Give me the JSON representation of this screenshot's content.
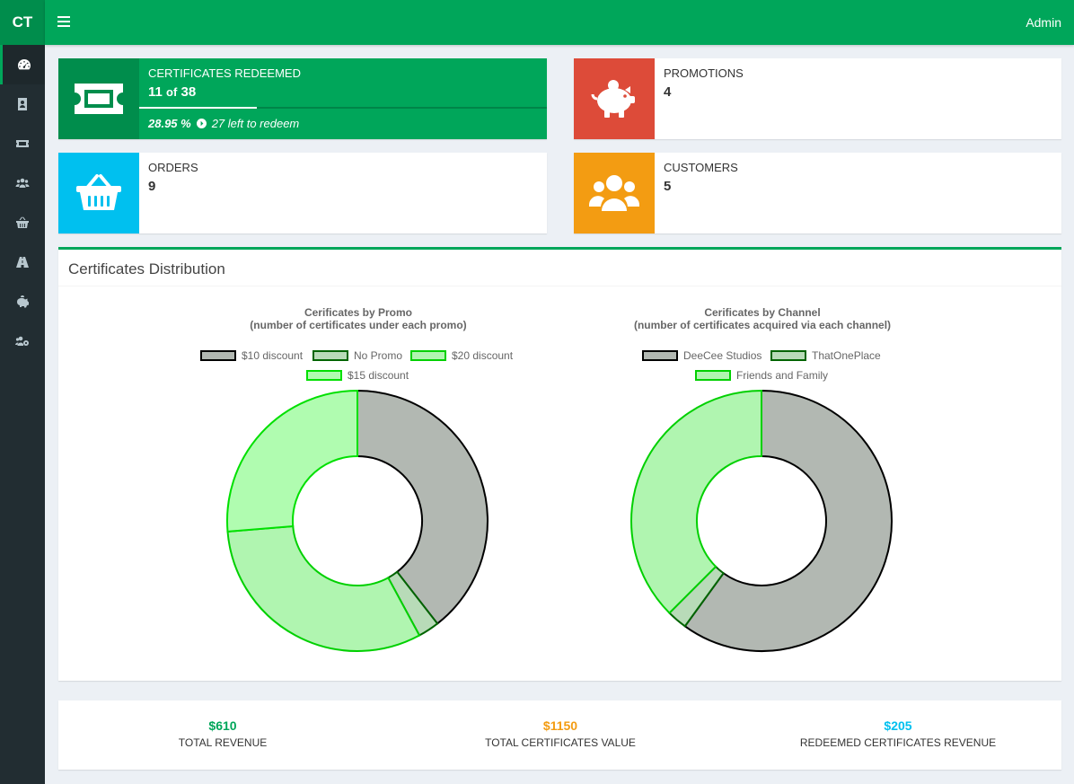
{
  "app": {
    "logo": "CT",
    "user": "Admin"
  },
  "sidebar": {
    "items": [
      {
        "icon": "dashboard-icon",
        "active": true
      },
      {
        "icon": "address-book-icon"
      },
      {
        "icon": "ticket-icon"
      },
      {
        "icon": "users-icon"
      },
      {
        "icon": "basket-icon"
      },
      {
        "icon": "road-icon"
      },
      {
        "icon": "piggy-bank-icon"
      },
      {
        "icon": "users-cog-icon"
      }
    ]
  },
  "info_boxes": {
    "certificates": {
      "label": "CERTIFICATES REDEEMED",
      "value": "11",
      "of": "of",
      "total": "38",
      "progress_percent": 28.95,
      "percent_text": "28.95 %",
      "left_text": "27 left to redeem",
      "color": "#00a65a"
    },
    "promotions": {
      "label": "PROMOTIONS",
      "value": "4",
      "color": "#dd4b39"
    },
    "orders": {
      "label": "ORDERS",
      "value": "9",
      "color": "#00c0ef"
    },
    "customers": {
      "label": "CUSTOMERS",
      "value": "5",
      "color": "#f39c12"
    }
  },
  "distribution": {
    "title": "Certificates Distribution"
  },
  "chart_data": [
    {
      "type": "pie",
      "title": "Cerificates by Promo",
      "subtitle": "(number of certificates under each promo)",
      "categories": [
        "$10 discount",
        "No Promo",
        "$20 discount",
        "$15 discount"
      ],
      "values": [
        15,
        1,
        12,
        10
      ],
      "colors": [
        "#b2b8b2",
        "#b8dbb8",
        "#b0f5b0",
        "#b0fcb0"
      ],
      "borders": [
        "#000000",
        "#006400",
        "#00d000",
        "#00e000"
      ]
    },
    {
      "type": "pie",
      "title": "Cerificates by Channel",
      "subtitle": "(number of certificates acquired via each channel)",
      "categories": [
        "DeeCee Studios",
        "ThatOnePlace",
        "Friends and Family"
      ],
      "values": [
        24,
        1,
        15
      ],
      "colors": [
        "#b2b8b2",
        "#b8dbb8",
        "#b0f5b0"
      ],
      "borders": [
        "#000000",
        "#006400",
        "#00d000"
      ]
    }
  ],
  "stats": [
    {
      "value": "$610",
      "label": "TOTAL REVENUE",
      "color": "#00a65a"
    },
    {
      "value": "$1150",
      "label": "TOTAL CERTIFICATES VALUE",
      "color": "#f39c12"
    },
    {
      "value": "$205",
      "label": "REDEEMED CERTIFICATES REVENUE",
      "color": "#00c0ef"
    }
  ]
}
